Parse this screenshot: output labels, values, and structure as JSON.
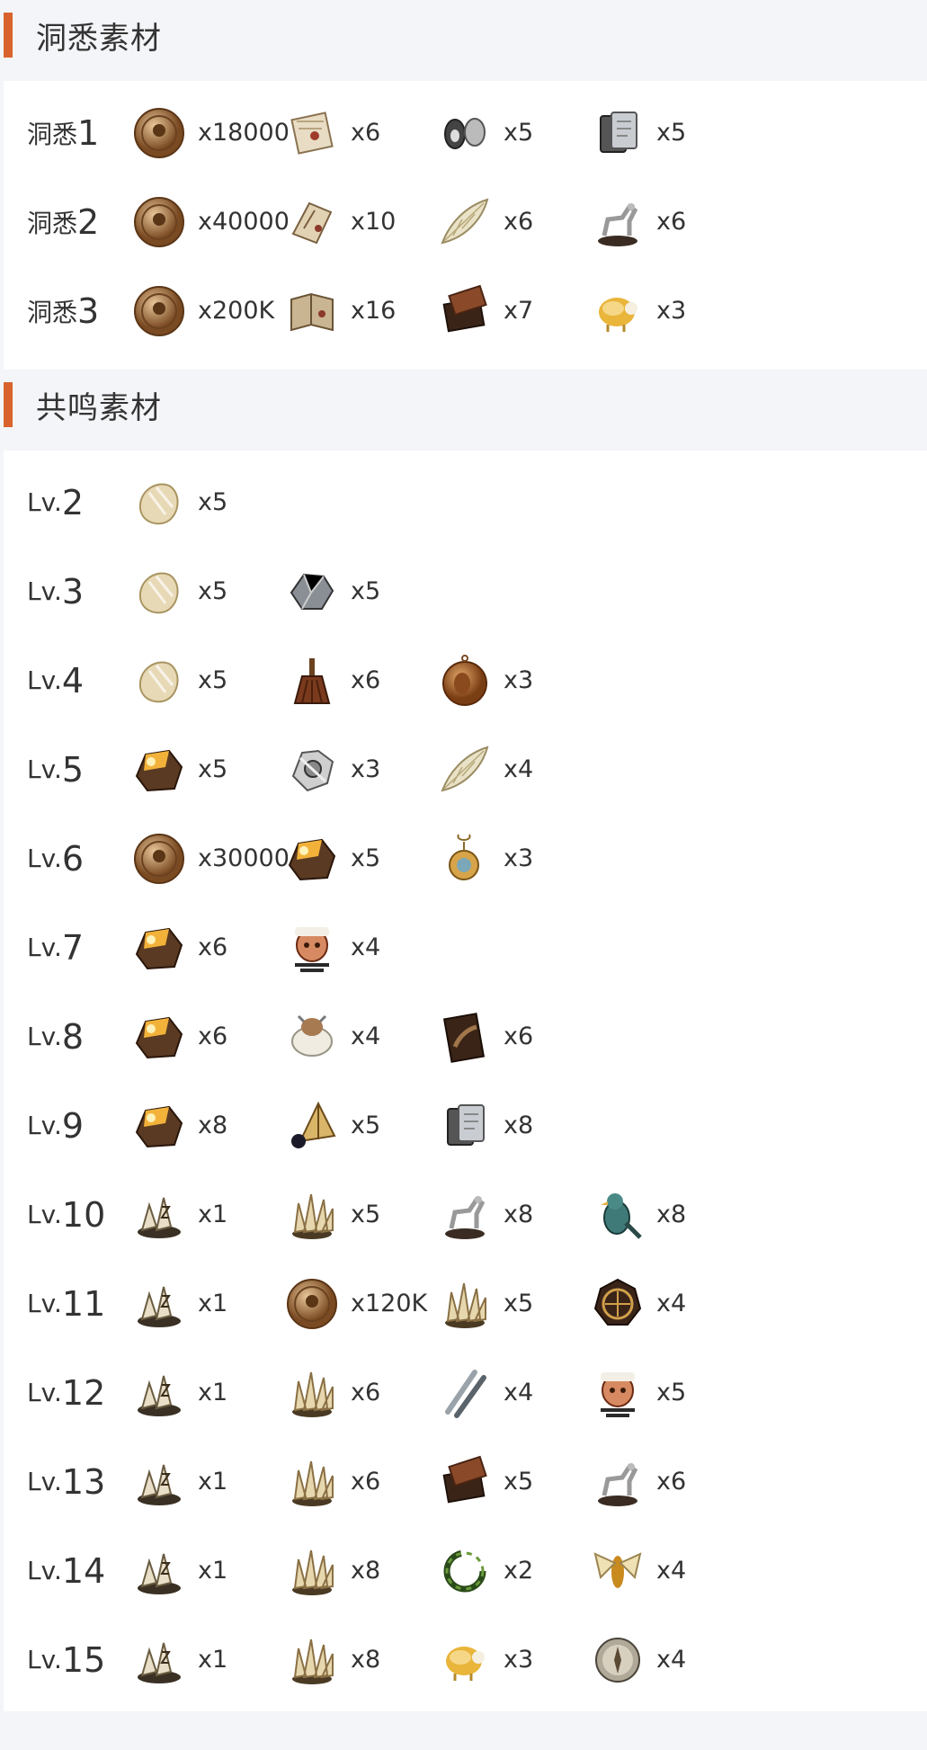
{
  "sections": [
    {
      "title": "洞悉素材",
      "rows": [
        {
          "label_pre": "洞悉",
          "label_num": "1",
          "items": [
            {
              "icon": "coin-icon",
              "qty": "x18000"
            },
            {
              "icon": "scroll-icon",
              "qty": "x6"
            },
            {
              "icon": "locket-icon",
              "qty": "x5"
            },
            {
              "icon": "tablet-icon",
              "qty": "x5"
            }
          ]
        },
        {
          "label_pre": "洞悉",
          "label_num": "2",
          "items": [
            {
              "icon": "coin-icon",
              "qty": "x40000"
            },
            {
              "icon": "parchment-icon",
              "qty": "x10"
            },
            {
              "icon": "wing-icon",
              "qty": "x6"
            },
            {
              "icon": "horse-statue-icon",
              "qty": "x6"
            }
          ]
        },
        {
          "label_pre": "洞悉",
          "label_num": "3",
          "items": [
            {
              "icon": "coin-icon",
              "qty": "x200K"
            },
            {
              "icon": "book-icon",
              "qty": "x16"
            },
            {
              "icon": "box-icon",
              "qty": "x7"
            },
            {
              "icon": "sheep-icon",
              "qty": "x3"
            }
          ]
        }
      ]
    },
    {
      "title": "共鸣素材",
      "rows": [
        {
          "label_pre": "Lv.",
          "label_num": "2",
          "items": [
            {
              "icon": "crystal-icon",
              "qty": "x5"
            }
          ]
        },
        {
          "label_pre": "Lv.",
          "label_num": "3",
          "items": [
            {
              "icon": "crystal-icon",
              "qty": "x5"
            },
            {
              "icon": "ore-icon",
              "qty": "x5"
            }
          ]
        },
        {
          "label_pre": "Lv.",
          "label_num": "4",
          "items": [
            {
              "icon": "crystal-icon",
              "qty": "x5"
            },
            {
              "icon": "brush-icon",
              "qty": "x6"
            },
            {
              "icon": "medal-icon",
              "qty": "x3"
            }
          ]
        },
        {
          "label_pre": "Lv.",
          "label_num": "5",
          "items": [
            {
              "icon": "glowing-rock-icon",
              "qty": "x5"
            },
            {
              "icon": "gear-fragment-icon",
              "qty": "x3"
            },
            {
              "icon": "wing-icon",
              "qty": "x4"
            }
          ]
        },
        {
          "label_pre": "Lv.",
          "label_num": "6",
          "items": [
            {
              "icon": "coin-icon",
              "qty": "x30000"
            },
            {
              "icon": "glowing-rock-icon",
              "qty": "x5"
            },
            {
              "icon": "pendant-icon",
              "qty": "x3"
            }
          ]
        },
        {
          "label_pre": "Lv.",
          "label_num": "7",
          "items": [
            {
              "icon": "glowing-rock-icon",
              "qty": "x6"
            },
            {
              "icon": "mask-icon",
              "qty": "x4"
            }
          ]
        },
        {
          "label_pre": "Lv.",
          "label_num": "8",
          "items": [
            {
              "icon": "glowing-rock-icon",
              "qty": "x6"
            },
            {
              "icon": "wool-sheep-icon",
              "qty": "x4"
            },
            {
              "icon": "card-icon",
              "qty": "x6"
            }
          ]
        },
        {
          "label_pre": "Lv.",
          "label_num": "9",
          "items": [
            {
              "icon": "glowing-rock-icon",
              "qty": "x8"
            },
            {
              "icon": "tent-icon",
              "qty": "x5"
            },
            {
              "icon": "tablet-icon",
              "qty": "x8"
            }
          ]
        },
        {
          "label_pre": "Lv.",
          "label_num": "10",
          "items": [
            {
              "icon": "rune-crystal-icon",
              "qty": "x1"
            },
            {
              "icon": "crystal-cluster-icon",
              "qty": "x5"
            },
            {
              "icon": "horse-statue-icon",
              "qty": "x8"
            },
            {
              "icon": "bird-icon",
              "qty": "x8"
            }
          ]
        },
        {
          "label_pre": "Lv.",
          "label_num": "11",
          "items": [
            {
              "icon": "rune-crystal-icon",
              "qty": "x1"
            },
            {
              "icon": "coin-icon",
              "qty": "x120K"
            },
            {
              "icon": "crystal-cluster-icon",
              "qty": "x5"
            },
            {
              "icon": "astrolabe-icon",
              "qty": "x4"
            }
          ]
        },
        {
          "label_pre": "Lv.",
          "label_num": "12",
          "items": [
            {
              "icon": "rune-crystal-icon",
              "qty": "x1"
            },
            {
              "icon": "crystal-cluster-icon",
              "qty": "x6"
            },
            {
              "icon": "rods-icon",
              "qty": "x4"
            },
            {
              "icon": "mask-icon",
              "qty": "x5"
            }
          ]
        },
        {
          "label_pre": "Lv.",
          "label_num": "13",
          "items": [
            {
              "icon": "rune-crystal-icon",
              "qty": "x1"
            },
            {
              "icon": "crystal-cluster-icon",
              "qty": "x6"
            },
            {
              "icon": "box-icon",
              "qty": "x5"
            },
            {
              "icon": "horse-statue-icon",
              "qty": "x6"
            }
          ]
        },
        {
          "label_pre": "Lv.",
          "label_num": "14",
          "items": [
            {
              "icon": "rune-crystal-icon",
              "qty": "x1"
            },
            {
              "icon": "crystal-cluster-icon",
              "qty": "x8"
            },
            {
              "icon": "wreath-icon",
              "qty": "x2"
            },
            {
              "icon": "moth-icon",
              "qty": "x4"
            }
          ]
        },
        {
          "label_pre": "Lv.",
          "label_num": "15",
          "items": [
            {
              "icon": "rune-crystal-icon",
              "qty": "x1"
            },
            {
              "icon": "crystal-cluster-icon",
              "qty": "x8"
            },
            {
              "icon": "sheep-icon",
              "qty": "x3"
            },
            {
              "icon": "compass-icon",
              "qty": "x4"
            }
          ]
        }
      ]
    }
  ]
}
